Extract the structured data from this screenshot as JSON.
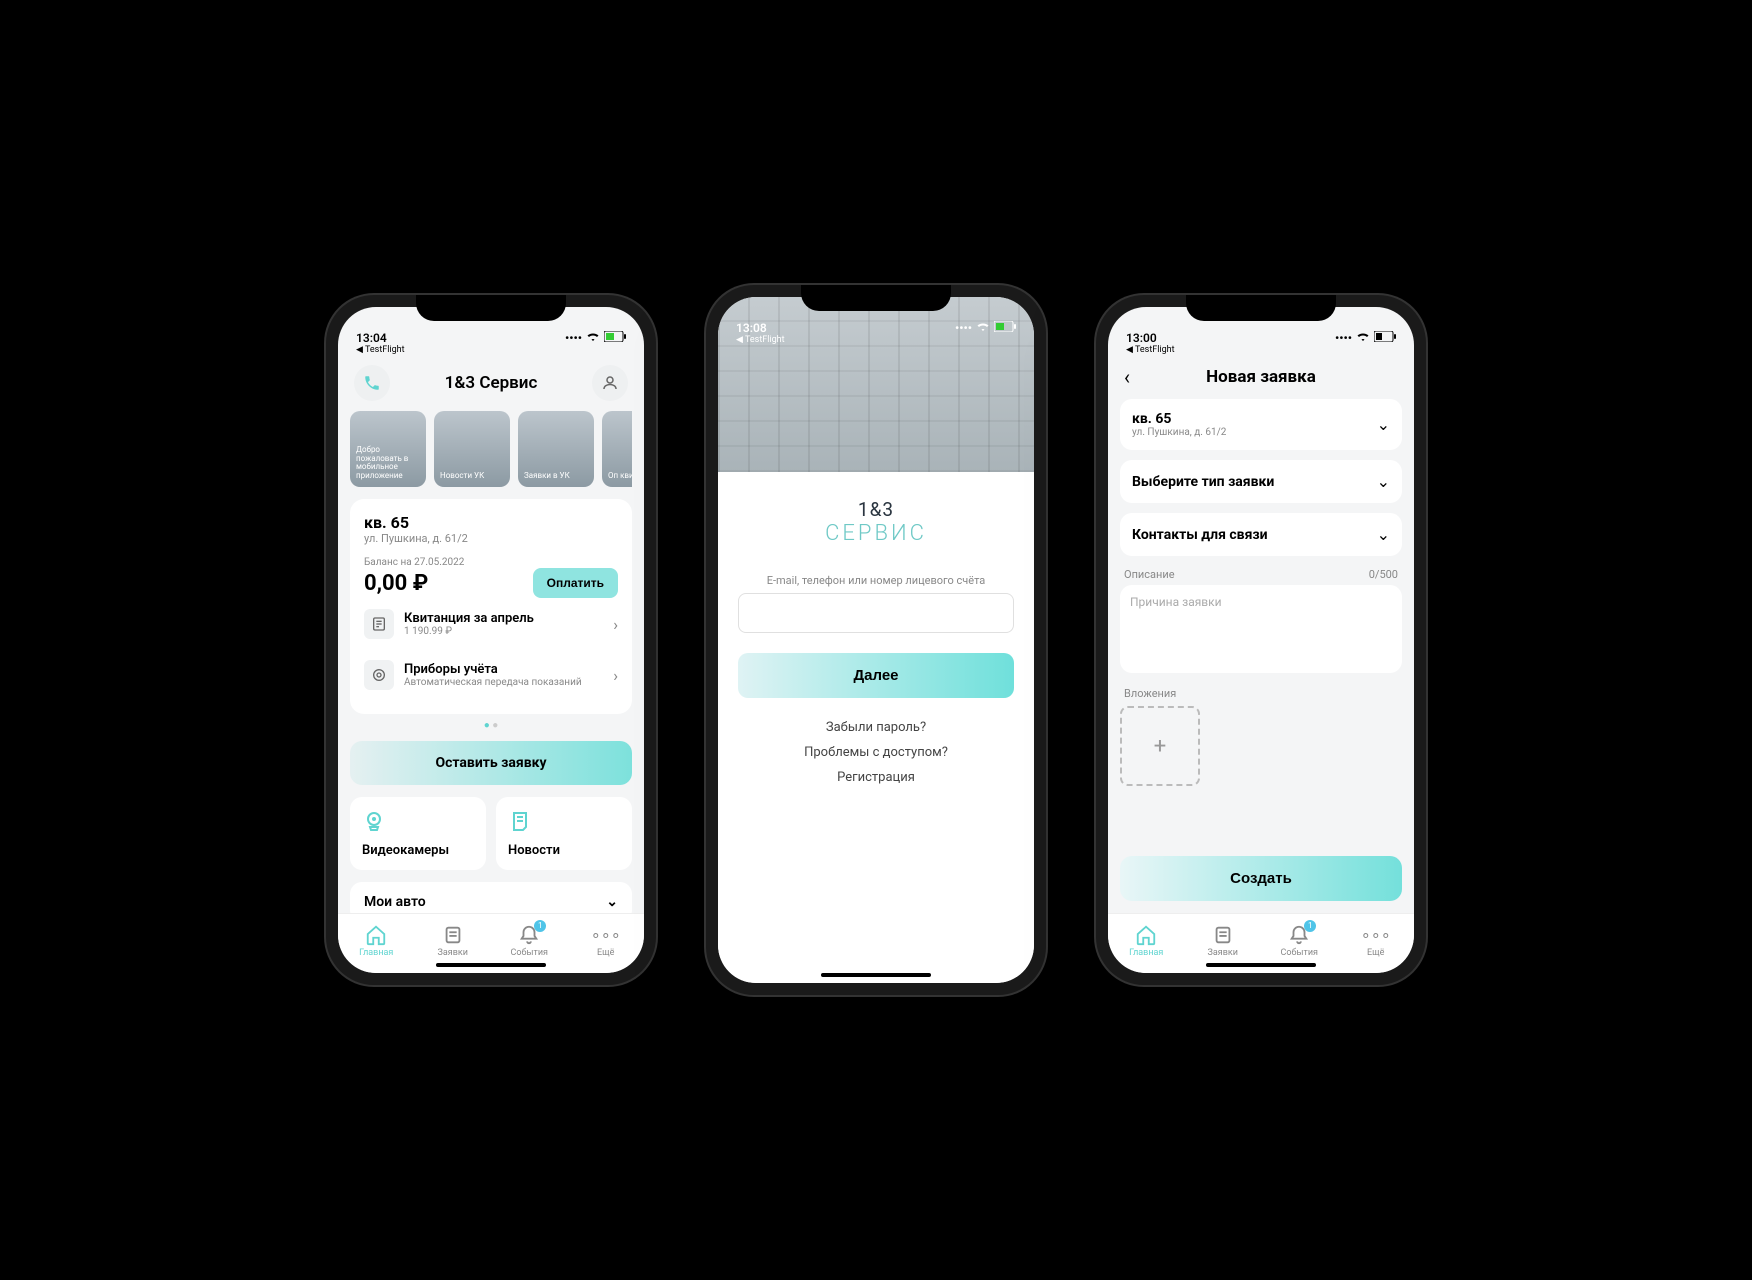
{
  "phone1": {
    "status_time": "13:04",
    "back_app": "◀ TestFlight",
    "app_title": "1&3 Сервис",
    "stories": [
      {
        "label": "Добро пожаловать в мобильное приложение"
      },
      {
        "label": "Новости УК"
      },
      {
        "label": "Заявки в УК"
      },
      {
        "label": "Оп квит"
      }
    ],
    "apartment": {
      "title": "кв. 65",
      "address": "ул. Пушкина, д. 61/2"
    },
    "balance": {
      "label_prefix": "Баланс ",
      "label_date": "на 27.05.2022",
      "amount": "0,00 ₽",
      "pay_label": "Оплатить"
    },
    "rows": [
      {
        "title": "Квитанция за апрель",
        "sub": "1 190.99 ₽"
      },
      {
        "title": "Приборы учёта",
        "sub": "Автоматическая передача показаний"
      }
    ],
    "cta_label": "Оставить заявку",
    "tiles": [
      {
        "label": "Видеокамеры"
      },
      {
        "label": "Новости"
      }
    ],
    "dropdown_label": "Мои авто",
    "tabs": [
      {
        "label": "Главная"
      },
      {
        "label": "Заявки"
      },
      {
        "label": "События",
        "badge": "1"
      },
      {
        "label": "Ещё"
      }
    ]
  },
  "phone2": {
    "status_time": "13:08",
    "back_app": "◀ TestFlight",
    "logo_line1": "1&3",
    "logo_line2": "СЕРВИС",
    "input_label": "E-mail, телефон или номер лицевого счёта",
    "next_btn": "Далее",
    "links": [
      "Забыли пароль?",
      "Проблемы с доступом?",
      "Регистрация"
    ]
  },
  "phone3": {
    "status_time": "13:00",
    "back_app": "◀ TestFlight",
    "title": "Новая заявка",
    "apartment": {
      "title": "кв. 65",
      "address": "ул. Пушкина, д. 61/2"
    },
    "type_label": "Выберите тип заявки",
    "contacts_label": "Контакты для связи",
    "desc_label": "Описание",
    "desc_counter": "0/500",
    "desc_placeholder": "Причина заявки",
    "attach_label": "Вложения",
    "create_btn": "Создать",
    "tabs": [
      {
        "label": "Главная"
      },
      {
        "label": "Заявки"
      },
      {
        "label": "События",
        "badge": "1"
      },
      {
        "label": "Ещё"
      }
    ]
  }
}
